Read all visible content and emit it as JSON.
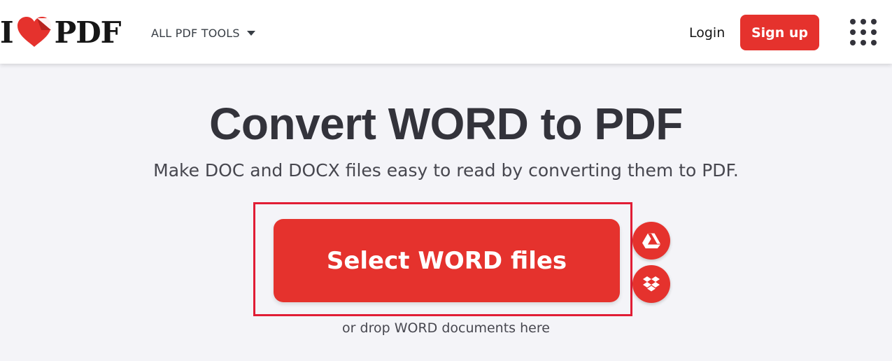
{
  "header": {
    "logo": {
      "left": "I",
      "right": "PDF"
    },
    "tools_menu_label": "ALL PDF TOOLS",
    "login_label": "Login",
    "signup_label": "Sign up"
  },
  "main": {
    "title": "Convert WORD to PDF",
    "subtitle": "Make DOC and DOCX files easy to read by converting them to PDF.",
    "select_button_label": "Select WORD files",
    "drop_hint": "or drop WORD documents here"
  },
  "colors": {
    "brand_red": "#e5322d",
    "highlight_border": "#e11d35",
    "page_background": "#f4f4f8",
    "text_dark": "#33333b"
  },
  "icons": {
    "logo_heart": "heart-icon",
    "tools_caret": "caret-down-icon",
    "apps": "apps-grid-icon",
    "google_drive": "google-drive-icon",
    "dropbox": "dropbox-icon"
  }
}
